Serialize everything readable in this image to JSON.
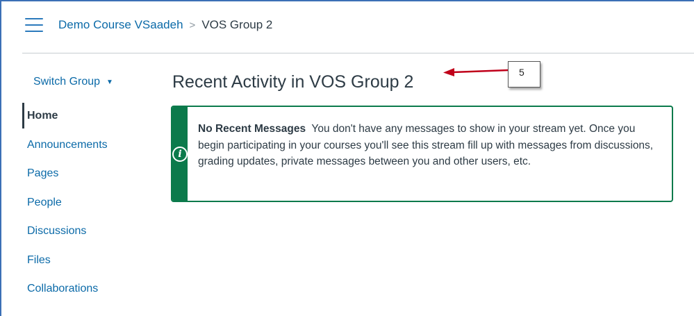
{
  "header": {
    "course_link": "Demo Course VSaadeh",
    "separator": ">",
    "current": "VOS Group 2"
  },
  "sidebar": {
    "switch_group": "Switch Group",
    "items": [
      {
        "label": "Home",
        "active": true
      },
      {
        "label": "Announcements"
      },
      {
        "label": "Pages"
      },
      {
        "label": "People"
      },
      {
        "label": "Discussions"
      },
      {
        "label": "Files"
      },
      {
        "label": "Collaborations"
      }
    ]
  },
  "main": {
    "title": "Recent Activity in VOS Group 2",
    "alert": {
      "heading": "No Recent Messages",
      "message": "You don't have any messages to show in your stream yet. Once you begin participating in your courses you'll see this stream fill up with messages from discussions, grading updates, private messages between you and other users, etc.",
      "icon": "info-icon"
    }
  },
  "annotation": {
    "number": "5"
  },
  "colors": {
    "link": "#0b6aa8",
    "alert_green": "#0b7a4b",
    "text": "#2d3b45",
    "annotation_arrow": "#c0001a"
  }
}
